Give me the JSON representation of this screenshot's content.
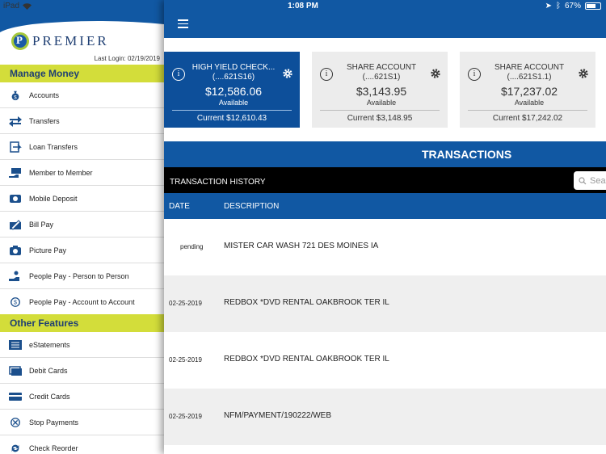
{
  "status": {
    "device": "iPad",
    "time": "1:08 PM",
    "battery": "67%"
  },
  "sidebar": {
    "brand": "PREMIER",
    "last_login": "Last Login:  02/19/2019",
    "sections": [
      {
        "title": "Manage Money",
        "items": [
          {
            "label": "Accounts",
            "icon": "money-bag-icon"
          },
          {
            "label": "Transfers",
            "icon": "transfer-arrows-icon"
          },
          {
            "label": "Loan Transfers",
            "icon": "loan-transfer-icon"
          },
          {
            "label": "Member to Member",
            "icon": "member-transfer-icon"
          },
          {
            "label": "Mobile Deposit",
            "icon": "mobile-deposit-icon"
          },
          {
            "label": "Bill Pay",
            "icon": "bill-pay-icon"
          },
          {
            "label": "Picture Pay",
            "icon": "camera-icon"
          },
          {
            "label": "People Pay - Person to Person",
            "icon": "person-pay-icon"
          },
          {
            "label": "People Pay - Account to Account",
            "icon": "account-pay-icon"
          }
        ]
      },
      {
        "title": "Other Features",
        "items": [
          {
            "label": "eStatements",
            "icon": "statement-icon"
          },
          {
            "label": "Debit Cards",
            "icon": "debit-card-icon"
          },
          {
            "label": "Credit Cards",
            "icon": "credit-card-icon"
          },
          {
            "label": "Stop Payments",
            "icon": "stop-icon"
          },
          {
            "label": "Check Reorder",
            "icon": "reorder-icon"
          }
        ]
      }
    ]
  },
  "accounts": [
    {
      "name": "HIGH YIELD CHECK...",
      "number": "(....621S16)",
      "balance": "$12,586.06",
      "available": "Available",
      "current": "Current $12,610.43",
      "selected": true
    },
    {
      "name": "SHARE ACCOUNT",
      "number": "(....621S1)",
      "balance": "$3,143.95",
      "available": "Available",
      "current": "Current $3,148.95",
      "selected": false
    },
    {
      "name": "SHARE ACCOUNT",
      "number": "(....621S1.1)",
      "balance": "$17,237.02",
      "available": "Available",
      "current": "Current $17,242.02",
      "selected": false
    }
  ],
  "transactions": {
    "title": "TRANSACTIONS",
    "history_label": "TRANSACTION HISTORY",
    "search_placeholder": "Sear",
    "columns": {
      "date": "DATE",
      "description": "DESCRIPTION"
    },
    "rows": [
      {
        "date": "pending",
        "description": "MISTER CAR WASH 721 DES MOINES IA"
      },
      {
        "date": "02-25-2019",
        "description": "REDBOX *DVD RENTAL OAKBROOK TER IL"
      },
      {
        "date": "02-25-2019",
        "description": "REDBOX *DVD RENTAL OAKBROOK TER IL"
      },
      {
        "date": "02-25-2019",
        "description": "NFM/PAYMENT/190222/WEB"
      }
    ]
  },
  "colors": {
    "primary": "#1158a3",
    "accent": "#d3dd3a",
    "card_active": "#0d4f9a"
  }
}
